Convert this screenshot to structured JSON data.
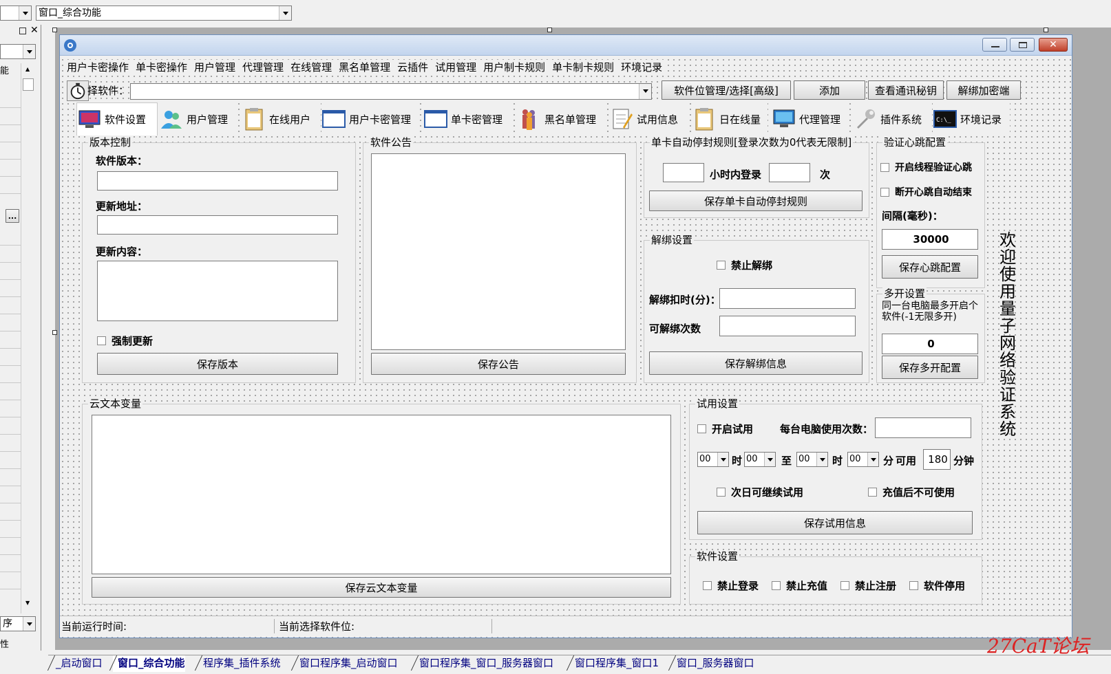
{
  "top": {
    "combo_left": "",
    "combo_window": "窗口_综合功能"
  },
  "left_panel": {
    "label_a": "能",
    "label_b": "序",
    "label_c": "性",
    "ellipsis": "..."
  },
  "menu": [
    "用户卡密操作",
    "单卡密操作",
    "用户管理",
    "代理管理",
    "在线管理",
    "黑名单管理",
    "云插件",
    "试用管理",
    "用户制卡规则",
    "单卡制卡规则",
    "环境记录"
  ],
  "toolbar": {
    "select_label": "择软件：",
    "software_value": "",
    "btn_select_slot": "软件位管理/选择[高级]",
    "btn_add": "添加",
    "btn_view_key": "查看通讯秘钥",
    "btn_unbind": "解绑加密端"
  },
  "tabs": [
    {
      "label": "软件设置",
      "icon": "monitor-icon"
    },
    {
      "label": "用户管理",
      "icon": "users-icon"
    },
    {
      "label": "在线用户",
      "icon": "clipboard-icon"
    },
    {
      "label": "用户卡密管理",
      "icon": "window-icon"
    },
    {
      "label": "单卡密管理",
      "icon": "window-icon"
    },
    {
      "label": "黑名单管理",
      "icon": "people-icon"
    },
    {
      "label": "试用信息",
      "icon": "notepad-icon"
    },
    {
      "label": "日在线量",
      "icon": "clipboard-icon"
    },
    {
      "label": "代理管理",
      "icon": "monitor-icon"
    },
    {
      "label": "插件系统",
      "icon": "wrench-icon"
    },
    {
      "label": "环境记录",
      "icon": "terminal-icon"
    }
  ],
  "version": {
    "legend": "版本控制",
    "version_label": "软件版本：",
    "version_value": "",
    "url_label": "更新地址：",
    "url_value": "",
    "content_label": "更新内容：",
    "content_value": "",
    "force_update": "强制更新",
    "save_btn": "保存版本"
  },
  "notice": {
    "legend": "软件公告",
    "content": "",
    "save_btn": "保存公告"
  },
  "autoban": {
    "legend": "单卡自动停封规则[登录次数为0代表无限制]",
    "hours_value": "",
    "hours_label": "小时内登录",
    "times_value": "",
    "times_label": "次",
    "save_btn": "保存单卡自动停封规则"
  },
  "unbind": {
    "legend": "解绑设置",
    "forbid": "禁止解绑",
    "deduct_label": "解绑扣时(分)：",
    "deduct_value": "",
    "count_label": "可解绑次数",
    "count_value": "",
    "save_btn": "保存解绑信息"
  },
  "heartbeat": {
    "legend": "验证心跳配置",
    "thread_check": "开启线程验证心跳",
    "disconnect_end": "断开心跳自动结束",
    "interval_label": "间隔(毫秒)：",
    "interval_value": "30000",
    "save_btn": "保存心跳配置"
  },
  "multi": {
    "legend": "多开设置",
    "desc": "同一台电脑最多开启个软件(-1无限多开)",
    "value": "0",
    "save_btn": "保存多开配置"
  },
  "welcome": "欢迎使用量子网络验证系统",
  "cloud_text": {
    "legend": "云文本变量",
    "content": "",
    "save_btn": "保存云文本变量"
  },
  "trial": {
    "legend": "试用设置",
    "enable": "开启试用",
    "per_pc_label": "每台电脑使用次数：",
    "per_pc_value": "",
    "h1": "00",
    "h1_label": "时",
    "m1": "00",
    "to_label": "至",
    "h2": "00",
    "h2_label": "时",
    "m2": "00",
    "minute_label": "分",
    "avail_label": "可用",
    "avail_value": "180",
    "avail_unit": "分钟",
    "next_day": "次日可继续试用",
    "after_recharge": "充值后不可使用",
    "save_btn": "保存试用信息"
  },
  "soft_settings": {
    "legend": "软件设置",
    "items": [
      "禁止登录",
      "禁止充值",
      "禁止注册",
      "软件停用"
    ]
  },
  "status": {
    "runtime_label": "当前运行时间:",
    "slot_label": "当前选择软件位:"
  },
  "bottom_tabs": [
    "_启动窗口",
    "窗口_综合功能",
    "程序集_插件系统",
    "窗口程序集_启动窗口",
    "窗口程序集_窗口_服务器窗口",
    "窗口程序集_窗口1",
    "窗口_服务器窗口"
  ],
  "watermark": "27CaT论坛"
}
